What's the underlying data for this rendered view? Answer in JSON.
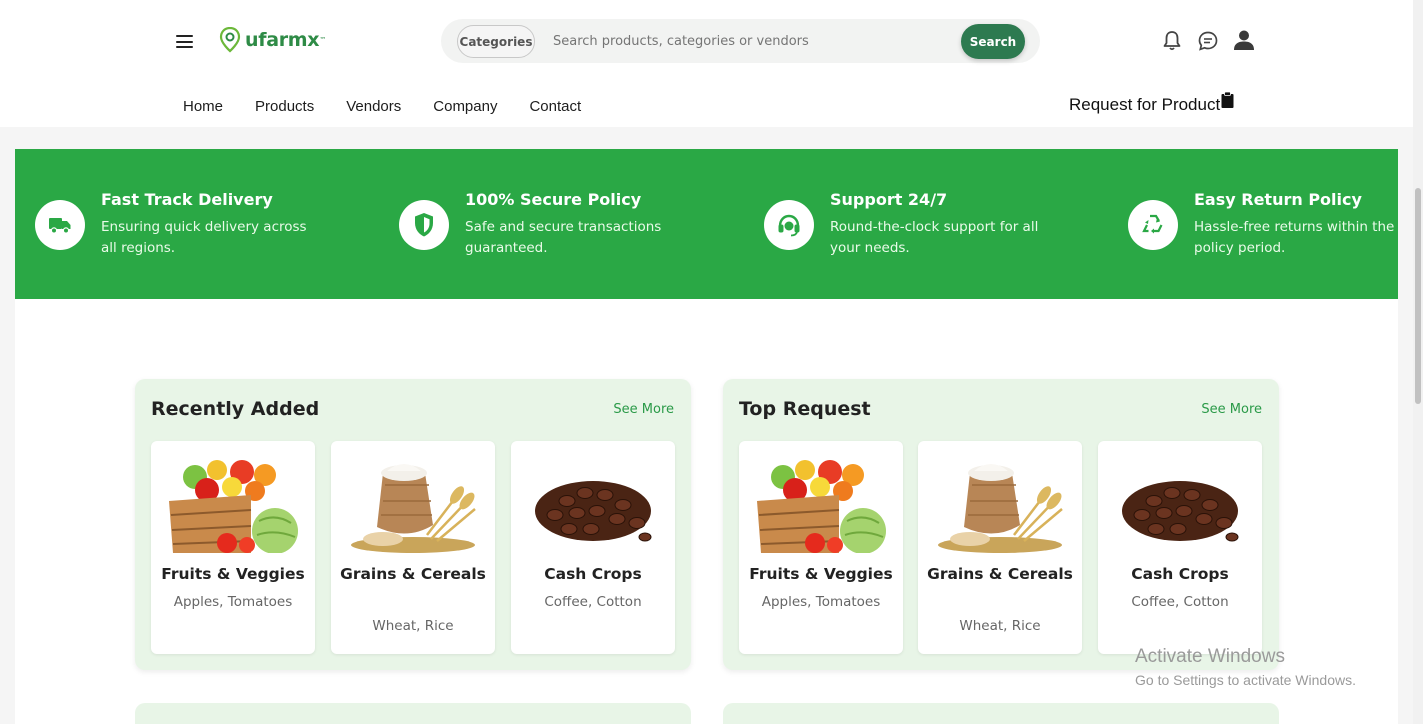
{
  "header": {
    "logo_text": "ufarmx",
    "logo_tm": "™",
    "search": {
      "categories_label": "Categories",
      "placeholder": "Search products, categories or vendors",
      "button_label": "Search"
    },
    "nav": [
      "Home",
      "Products",
      "Vendors",
      "Company",
      "Contact"
    ],
    "request_label": "Request for Product"
  },
  "features": [
    {
      "icon": "truck-icon",
      "title": "Fast Track Delivery",
      "desc": "Ensuring quick delivery across all regions."
    },
    {
      "icon": "shield-icon",
      "title": "100% Secure Policy",
      "desc": "Safe and secure transactions guaranteed."
    },
    {
      "icon": "headset-icon",
      "title": "Support 24/7",
      "desc": "Round-the-clock support for all your needs."
    },
    {
      "icon": "recycle-icon",
      "title": "Easy Return Policy",
      "desc": "Hassle-free returns within the policy period."
    }
  ],
  "panels": [
    {
      "title": "Recently Added",
      "see_more": "See More",
      "cards": [
        {
          "name": "Fruits & Veggies",
          "sub": "Apples, Tomatoes",
          "image": "vegetable-crate-image"
        },
        {
          "name": "Grains & Cereals",
          "sub": "Wheat, Rice",
          "image": "grain-sack-image"
        },
        {
          "name": "Cash Crops",
          "sub": "Coffee, Cotton",
          "image": "coffee-beans-image"
        }
      ]
    },
    {
      "title": "Top Request",
      "see_more": "See More",
      "cards": [
        {
          "name": "Fruits & Veggies",
          "sub": "Apples, Tomatoes",
          "image": "vegetable-crate-image"
        },
        {
          "name": "Grains & Cereals",
          "sub": "Wheat, Rice",
          "image": "grain-sack-image"
        },
        {
          "name": "Cash Crops",
          "sub": "Coffee, Cotton",
          "image": "coffee-beans-image"
        }
      ]
    }
  ],
  "watermark": {
    "line1": "Activate Windows",
    "line2": "Go to Settings to activate Windows."
  },
  "colors": {
    "brand_green": "#2aa845",
    "dark_green": "#2d7a50",
    "panel_bg": "#e8f5e7"
  }
}
